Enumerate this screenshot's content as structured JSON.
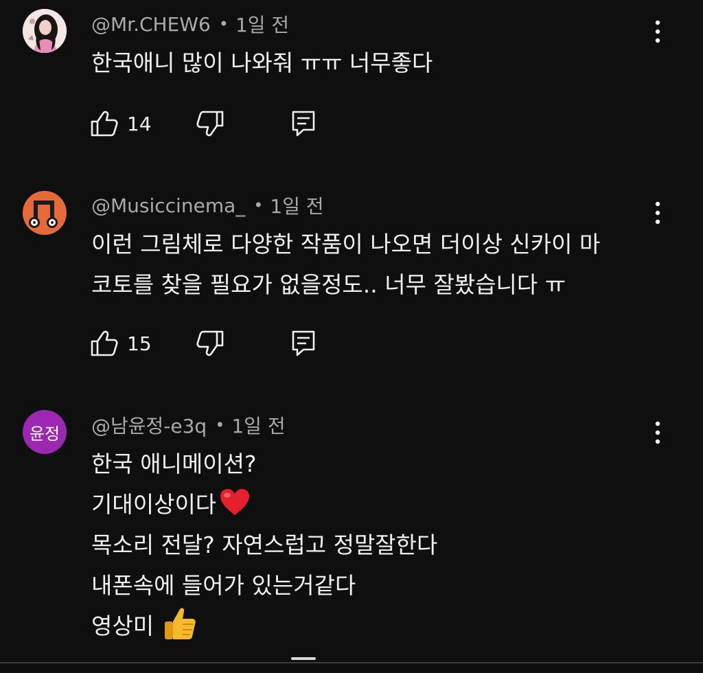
{
  "comments": [
    {
      "handle": "@Mr.CHEW6",
      "separator": "•",
      "time": "1일 전",
      "lines": [
        "한국애니 많이 나와줘 ㅠㅠ 너무좋다"
      ],
      "likes": "14",
      "avatar": "photo-avatar"
    },
    {
      "handle": "@Musiccinema_",
      "separator": "•",
      "time": "1일 전",
      "lines": [
        "이런 그림체로 다양한 작품이 나오면 더이상 신카이 마",
        "코토를 찾을 필요가 없을정도.. 너무 잘봤습니다 ㅠ"
      ],
      "likes": "15",
      "avatar": "music-note-avatar"
    },
    {
      "handle": "@남윤정-e3q",
      "separator": "•",
      "time": "1일 전",
      "avatar_initials": "윤정",
      "avatar_color": "#9c27b0",
      "lines": [
        "한국 애니메이션?",
        "기대이상이다",
        "목소리 전달? 자연스럽고 정말잘한다",
        "내폰속에 들어가 있는거같다",
        "영상미"
      ],
      "emojis": [
        "red-heart",
        "thumbs-up"
      ]
    }
  ],
  "icons": {
    "like": "thumb-up-outline-icon",
    "dislike": "thumb-down-outline-icon",
    "reply": "reply-comment-icon",
    "more": "vertical-dots-icon"
  },
  "colors": {
    "background": "#0f0f0f",
    "primary_text": "#f1f1f1",
    "secondary_text": "#aaaaaa"
  }
}
